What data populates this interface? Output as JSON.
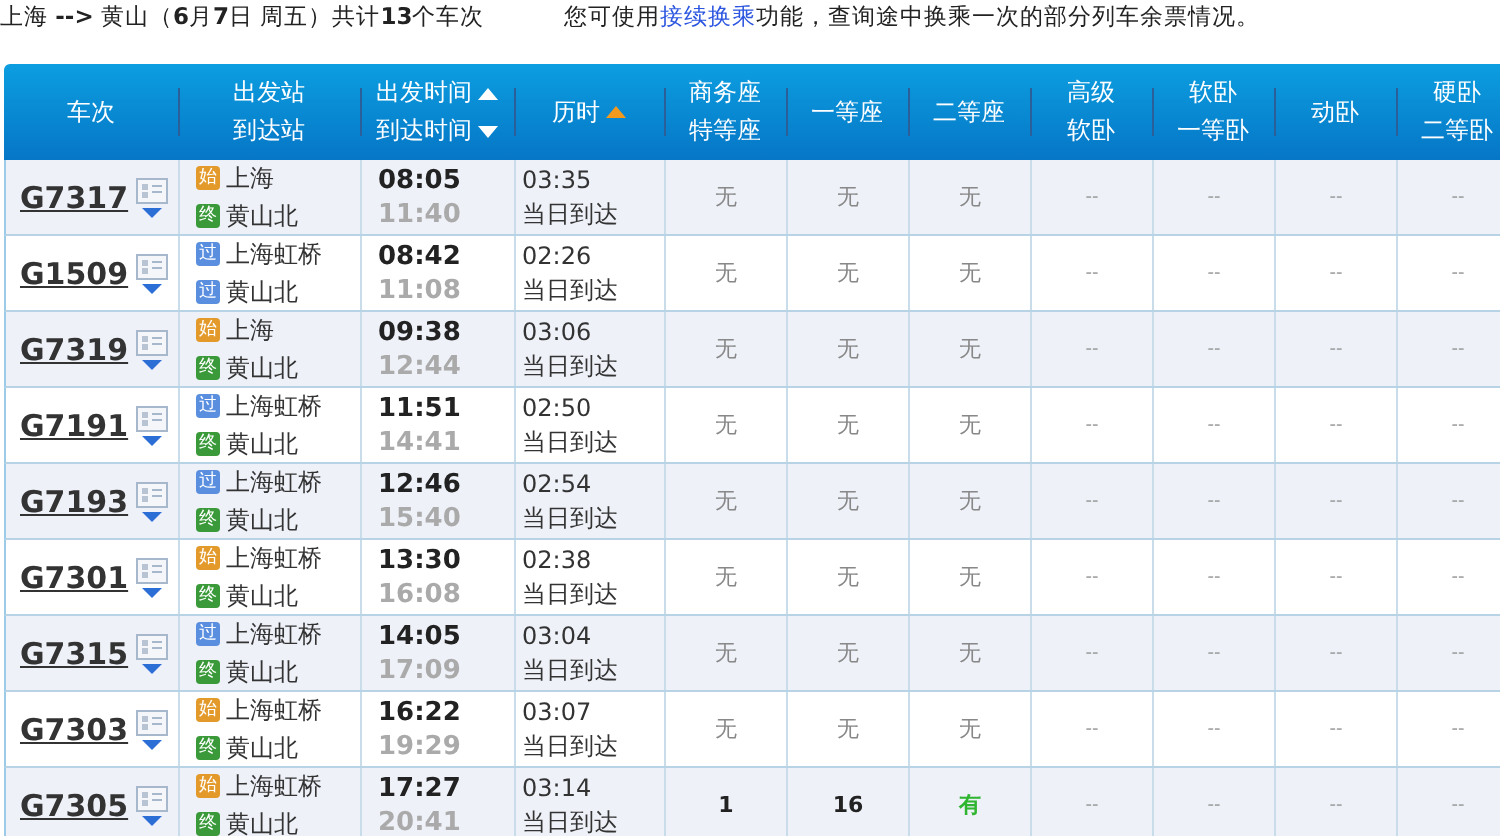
{
  "summary": "上海 **-->** 黄山（**6**月**7**日 周五）共计**13**个车次",
  "notice": {
    "before": "您可使用",
    "link": "接续换乘",
    "after": "功能，查询途中换乘一次的部分列车余票情况。"
  },
  "columns": [
    {
      "lines": [
        {
          "text": "车次"
        }
      ]
    },
    {
      "lines": [
        {
          "text": "出发站"
        },
        {
          "text": "到达站"
        }
      ]
    },
    {
      "lines": [
        {
          "text": "出发时间",
          "kind": "ascending",
          "highlighted": false
        },
        {
          "text": "到达时间",
          "kind": "descending",
          "highlighted": false
        }
      ]
    },
    {
      "lines": [
        {
          "text": "历时",
          "kind": "ascending",
          "highlighted": true
        }
      ]
    },
    {
      "lines": [
        {
          "text": "商务座"
        },
        {
          "text": "特等座"
        }
      ]
    },
    {
      "lines": [
        {
          "text": "一等座"
        }
      ]
    },
    {
      "lines": [
        {
          "text": "二等座"
        }
      ]
    },
    {
      "lines": [
        {
          "text": "高级"
        },
        {
          "text": "软卧"
        }
      ]
    },
    {
      "lines": [
        {
          "text": "软卧"
        },
        {
          "text": "一等卧"
        }
      ]
    },
    {
      "lines": [
        {
          "text": "动卧"
        }
      ]
    },
    {
      "lines": [
        {
          "text": "硬卧"
        },
        {
          "text": "二等卧"
        }
      ]
    }
  ],
  "rows": [
    {
      "train": "G7317",
      "from": {
        "badge": "始",
        "kind": "start",
        "name": "上海"
      },
      "to": {
        "badge": "终",
        "kind": "end",
        "name": "黄山北"
      },
      "depart": "08:05",
      "arrive": "11:40",
      "duration": "03:35",
      "arrival_day": "当日到达",
      "seats": [
        {
          "text": "无",
          "kind": "none"
        },
        {
          "text": "无",
          "kind": "none"
        },
        {
          "text": "无",
          "kind": "none"
        },
        {
          "text": "--",
          "kind": "na"
        },
        {
          "text": "--",
          "kind": "na"
        },
        {
          "text": "--",
          "kind": "na"
        },
        {
          "text": "--",
          "kind": "na"
        }
      ]
    },
    {
      "train": "G1509",
      "from": {
        "badge": "过",
        "kind": "pass",
        "name": "上海虹桥"
      },
      "to": {
        "badge": "过",
        "kind": "pass",
        "name": "黄山北"
      },
      "depart": "08:42",
      "arrive": "11:08",
      "duration": "02:26",
      "arrival_day": "当日到达",
      "seats": [
        {
          "text": "无",
          "kind": "none"
        },
        {
          "text": "无",
          "kind": "none"
        },
        {
          "text": "无",
          "kind": "none"
        },
        {
          "text": "--",
          "kind": "na"
        },
        {
          "text": "--",
          "kind": "na"
        },
        {
          "text": "--",
          "kind": "na"
        },
        {
          "text": "--",
          "kind": "na"
        }
      ]
    },
    {
      "train": "G7319",
      "from": {
        "badge": "始",
        "kind": "start",
        "name": "上海"
      },
      "to": {
        "badge": "终",
        "kind": "end",
        "name": "黄山北"
      },
      "depart": "09:38",
      "arrive": "12:44",
      "duration": "03:06",
      "arrival_day": "当日到达",
      "seats": [
        {
          "text": "无",
          "kind": "none"
        },
        {
          "text": "无",
          "kind": "none"
        },
        {
          "text": "无",
          "kind": "none"
        },
        {
          "text": "--",
          "kind": "na"
        },
        {
          "text": "--",
          "kind": "na"
        },
        {
          "text": "--",
          "kind": "na"
        },
        {
          "text": "--",
          "kind": "na"
        }
      ]
    },
    {
      "train": "G7191",
      "from": {
        "badge": "过",
        "kind": "pass",
        "name": "上海虹桥"
      },
      "to": {
        "badge": "终",
        "kind": "end",
        "name": "黄山北"
      },
      "depart": "11:51",
      "arrive": "14:41",
      "duration": "02:50",
      "arrival_day": "当日到达",
      "seats": [
        {
          "text": "无",
          "kind": "none"
        },
        {
          "text": "无",
          "kind": "none"
        },
        {
          "text": "无",
          "kind": "none"
        },
        {
          "text": "--",
          "kind": "na"
        },
        {
          "text": "--",
          "kind": "na"
        },
        {
          "text": "--",
          "kind": "na"
        },
        {
          "text": "--",
          "kind": "na"
        }
      ]
    },
    {
      "train": "G7193",
      "from": {
        "badge": "过",
        "kind": "pass",
        "name": "上海虹桥"
      },
      "to": {
        "badge": "终",
        "kind": "end",
        "name": "黄山北"
      },
      "depart": "12:46",
      "arrive": "15:40",
      "duration": "02:54",
      "arrival_day": "当日到达",
      "seats": [
        {
          "text": "无",
          "kind": "none"
        },
        {
          "text": "无",
          "kind": "none"
        },
        {
          "text": "无",
          "kind": "none"
        },
        {
          "text": "--",
          "kind": "na"
        },
        {
          "text": "--",
          "kind": "na"
        },
        {
          "text": "--",
          "kind": "na"
        },
        {
          "text": "--",
          "kind": "na"
        }
      ]
    },
    {
      "train": "G7301",
      "from": {
        "badge": "始",
        "kind": "start",
        "name": "上海虹桥"
      },
      "to": {
        "badge": "终",
        "kind": "end",
        "name": "黄山北"
      },
      "depart": "13:30",
      "arrive": "16:08",
      "duration": "02:38",
      "arrival_day": "当日到达",
      "seats": [
        {
          "text": "无",
          "kind": "none"
        },
        {
          "text": "无",
          "kind": "none"
        },
        {
          "text": "无",
          "kind": "none"
        },
        {
          "text": "--",
          "kind": "na"
        },
        {
          "text": "--",
          "kind": "na"
        },
        {
          "text": "--",
          "kind": "na"
        },
        {
          "text": "--",
          "kind": "na"
        }
      ]
    },
    {
      "train": "G7315",
      "from": {
        "badge": "过",
        "kind": "pass",
        "name": "上海虹桥"
      },
      "to": {
        "badge": "终",
        "kind": "end",
        "name": "黄山北"
      },
      "depart": "14:05",
      "arrive": "17:09",
      "duration": "03:04",
      "arrival_day": "当日到达",
      "seats": [
        {
          "text": "无",
          "kind": "none"
        },
        {
          "text": "无",
          "kind": "none"
        },
        {
          "text": "无",
          "kind": "none"
        },
        {
          "text": "--",
          "kind": "na"
        },
        {
          "text": "--",
          "kind": "na"
        },
        {
          "text": "--",
          "kind": "na"
        },
        {
          "text": "--",
          "kind": "na"
        }
      ]
    },
    {
      "train": "G7303",
      "from": {
        "badge": "始",
        "kind": "start",
        "name": "上海虹桥"
      },
      "to": {
        "badge": "终",
        "kind": "end",
        "name": "黄山北"
      },
      "depart": "16:22",
      "arrive": "19:29",
      "duration": "03:07",
      "arrival_day": "当日到达",
      "seats": [
        {
          "text": "无",
          "kind": "none"
        },
        {
          "text": "无",
          "kind": "none"
        },
        {
          "text": "无",
          "kind": "none"
        },
        {
          "text": "--",
          "kind": "na"
        },
        {
          "text": "--",
          "kind": "na"
        },
        {
          "text": "--",
          "kind": "na"
        },
        {
          "text": "--",
          "kind": "na"
        }
      ]
    },
    {
      "train": "G7305",
      "from": {
        "badge": "始",
        "kind": "start",
        "name": "上海虹桥"
      },
      "to": {
        "badge": "终",
        "kind": "end",
        "name": "黄山北"
      },
      "depart": "17:27",
      "arrive": "20:41",
      "duration": "03:14",
      "arrival_day": "当日到达",
      "seats": [
        {
          "text": "1",
          "kind": "count"
        },
        {
          "text": "16",
          "kind": "count"
        },
        {
          "text": "有",
          "kind": "available"
        },
        {
          "text": "--",
          "kind": "na"
        },
        {
          "text": "--",
          "kind": "na"
        },
        {
          "text": "--",
          "kind": "na"
        },
        {
          "text": "--",
          "kind": "na"
        }
      ]
    }
  ]
}
